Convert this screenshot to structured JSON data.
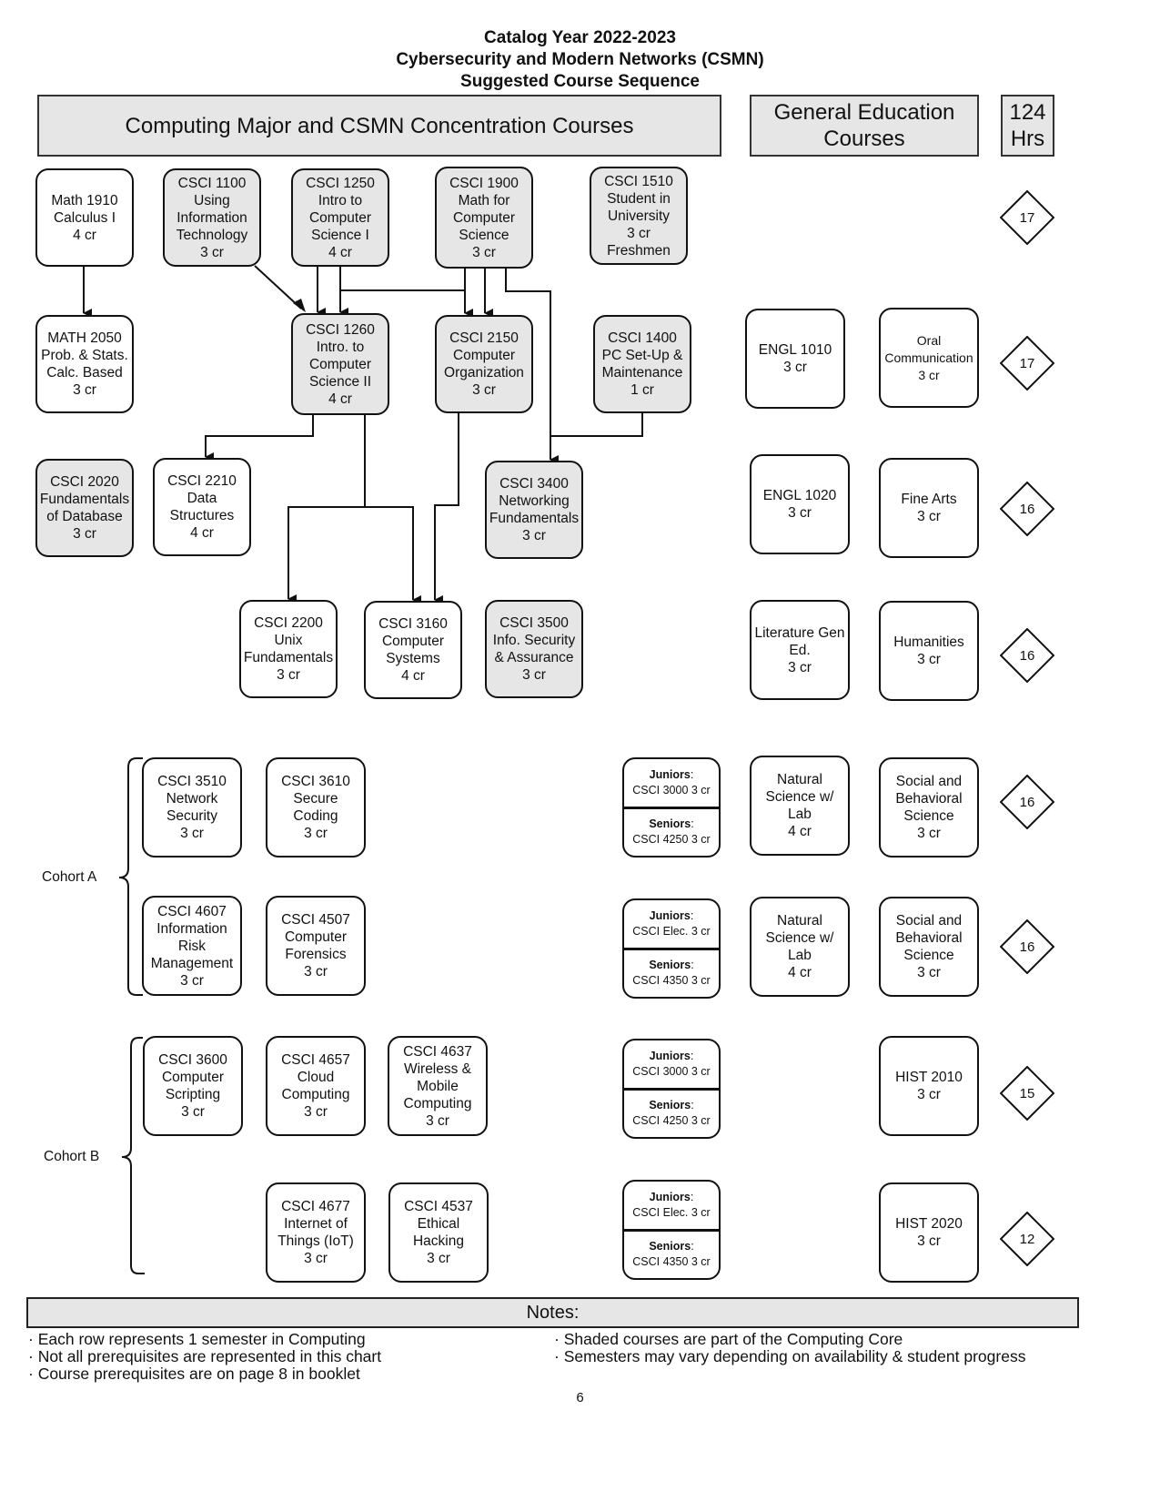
{
  "title": {
    "line1": "Catalog Year 2022-2023",
    "line2": "Cybersecurity and Modern Networks (CSMN)",
    "line3": "Suggested Course Sequence"
  },
  "headers": {
    "major": "Computing Major and CSMN Concentration Courses",
    "gen_ed": "General Education\nCourses",
    "hours": "124\nHrs"
  },
  "courses": {
    "math1910": "Math 1910\nCalculus I\n4 cr",
    "csci1100": "CSCI 1100\nUsing\nInformation\nTechnology\n3 cr",
    "csci1250": "CSCI 1250\nIntro to\nComputer\nScience I\n4 cr",
    "csci1900": "CSCI 1900\nMath for\nComputer\nScience\n3 cr",
    "csci1510": "CSCI 1510\nStudent in\nUniversity\n3 cr\nFreshmen",
    "math2050": "MATH 2050\nProb. & Stats.\nCalc. Based\n3 cr",
    "csci1260": "CSCI 1260\nIntro. to\nComputer\nScience II\n4 cr",
    "csci2150": "CSCI 2150\nComputer\nOrganization\n3 cr",
    "csci1400": "CSCI 1400\nPC Set-Up &\nMaintenance\n1 cr",
    "csci2020": "CSCI 2020\nFundamentals\nof Database\n3 cr",
    "csci2210": "CSCI 2210\nData\nStructures\n4 cr",
    "csci3400": "CSCI 3400\nNetworking\nFundamentals\n3 cr",
    "csci2200": "CSCI 2200\nUnix\nFundamentals\n3 cr",
    "csci3160": "CSCI 3160\nComputer\nSystems\n4 cr",
    "csci3500": "CSCI 3500\nInfo. Security\n& Assurance\n3 cr",
    "csci3510": "CSCI 3510\nNetwork\nSecurity\n3 cr",
    "csci3610": "CSCI 3610\nSecure\nCoding\n3 cr",
    "csci4607": "CSCI 4607\nInformation\nRisk\nManagement\n3 cr",
    "csci4507": "CSCI 4507\nComputer\nForensics\n3 cr",
    "csci3600": "CSCI 3600\nComputer\nScripting\n3 cr",
    "csci4657": "CSCI 4657\nCloud\nComputing\n3 cr",
    "csci4637": "CSCI 4637\nWireless &\nMobile\nComputing\n3 cr",
    "csci4677": "CSCI 4677\nInternet of\nThings (IoT)\n3 cr",
    "csci4537": "CSCI 4537\nEthical\nHacking\n3 cr"
  },
  "gen_ed": {
    "engl1010": "ENGL 1010\n3 cr",
    "oral_comm": "Oral\nCommunication\n3 cr",
    "engl1020": "ENGL 1020\n3 cr",
    "fine_arts": "Fine Arts\n3 cr",
    "literature": "Literature Gen\nEd.\n3 cr",
    "humanities": "Humanities\n3 cr",
    "nat_sci_1": "Natural\nScience w/\nLab\n4 cr",
    "soc_beh_1": "Social and\nBehavioral\nScience\n3 cr",
    "nat_sci_2": "Natural\nScience w/\nLab\n4 cr",
    "soc_beh_2": "Social and\nBehavioral\nScience\n3 cr",
    "hist2010": "HIST 2010\n3 cr",
    "hist2020": "HIST 2020\n3 cr"
  },
  "split_boxes": [
    {
      "juniors_label": "Juniors",
      "juniors_course": "CSCI 3000 3 cr",
      "seniors_label": "Seniors",
      "seniors_course": "CSCI 4250 3 cr"
    },
    {
      "juniors_label": "Juniors",
      "juniors_course": "CSCI Elec. 3 cr",
      "seniors_label": "Seniors",
      "seniors_course": "CSCI 4350 3 cr"
    },
    {
      "juniors_label": "Juniors",
      "juniors_course": "CSCI 3000 3 cr",
      "seniors_label": "Seniors",
      "seniors_course": "CSCI 4250 3 cr"
    },
    {
      "juniors_label": "Juniors",
      "juniors_course": "CSCI Elec. 3 cr",
      "seniors_label": "Seniors",
      "seniors_course": "CSCI 4350 3 cr"
    }
  ],
  "semester_hours": [
    "17",
    "17",
    "16",
    "16",
    "16",
    "16",
    "15",
    "12"
  ],
  "cohorts": {
    "a": "Cohort A",
    "b": "Cohort B"
  },
  "notes": {
    "title": "Notes:",
    "left": [
      "· Each row represents 1 semester in Computing",
      "· Not all prerequisites are represented in this chart",
      "· Course prerequisites are on page 8 in booklet"
    ],
    "right": [
      "· Shaded courses are part of the Computing Core",
      "· Semesters may vary depending on availability & student progress"
    ]
  },
  "page_number": "6"
}
